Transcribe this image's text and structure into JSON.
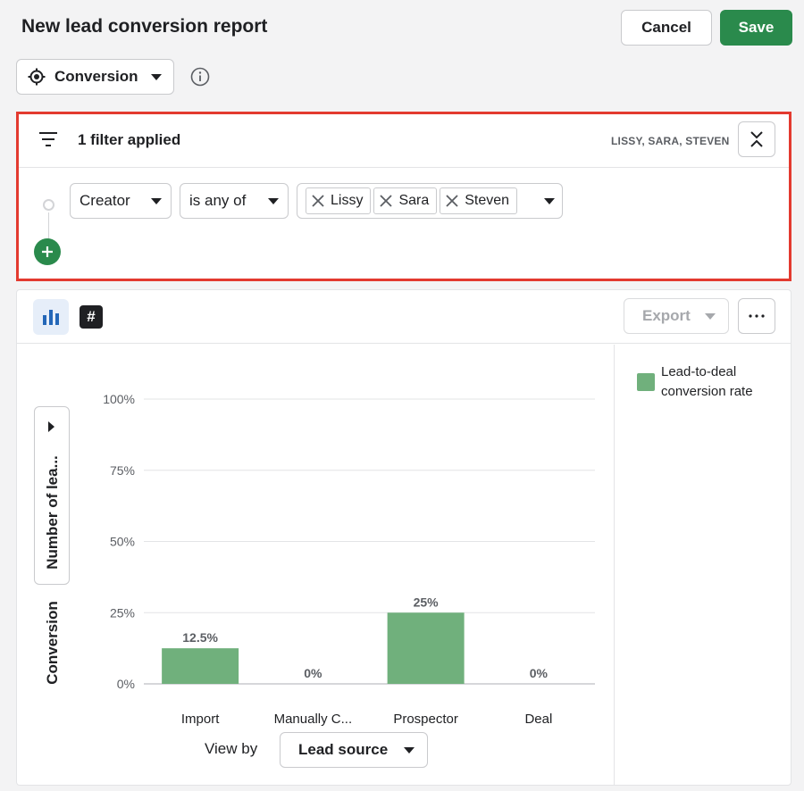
{
  "header": {
    "title": "New lead conversion report",
    "cancel_label": "Cancel",
    "save_label": "Save"
  },
  "report_type": {
    "label": "Conversion"
  },
  "filter": {
    "count_text": "1 filter applied",
    "summary": "LISSY, SARA, STEVEN",
    "field": "Creator",
    "operator": "is any of",
    "values": [
      "Lissy",
      "Sara",
      "Steven"
    ]
  },
  "toolbar": {
    "export_label": "Export"
  },
  "axis": {
    "selector_label": "Number of lea...",
    "y_title": "Conversion"
  },
  "view_by": {
    "label": "View by",
    "value": "Lead source"
  },
  "colors": {
    "bar": "#70b07c",
    "save": "#2a8a4c",
    "highlight": "#e33a2f"
  },
  "chart_data": {
    "type": "bar",
    "categories": [
      "Import",
      "Manually C...",
      "Prospector",
      "Deal"
    ],
    "series": [
      {
        "name": "Lead-to-deal conversion rate",
        "values": [
          12.5,
          0,
          25,
          0
        ]
      }
    ],
    "data_labels": [
      "12.5%",
      "0%",
      "25%",
      "0%"
    ],
    "yticks": [
      "0%",
      "25%",
      "50%",
      "75%",
      "100%"
    ],
    "ylim": [
      0,
      100
    ],
    "ylabel": "Conversion",
    "xlabel": "Lead source",
    "grid": true,
    "legend": "right"
  }
}
